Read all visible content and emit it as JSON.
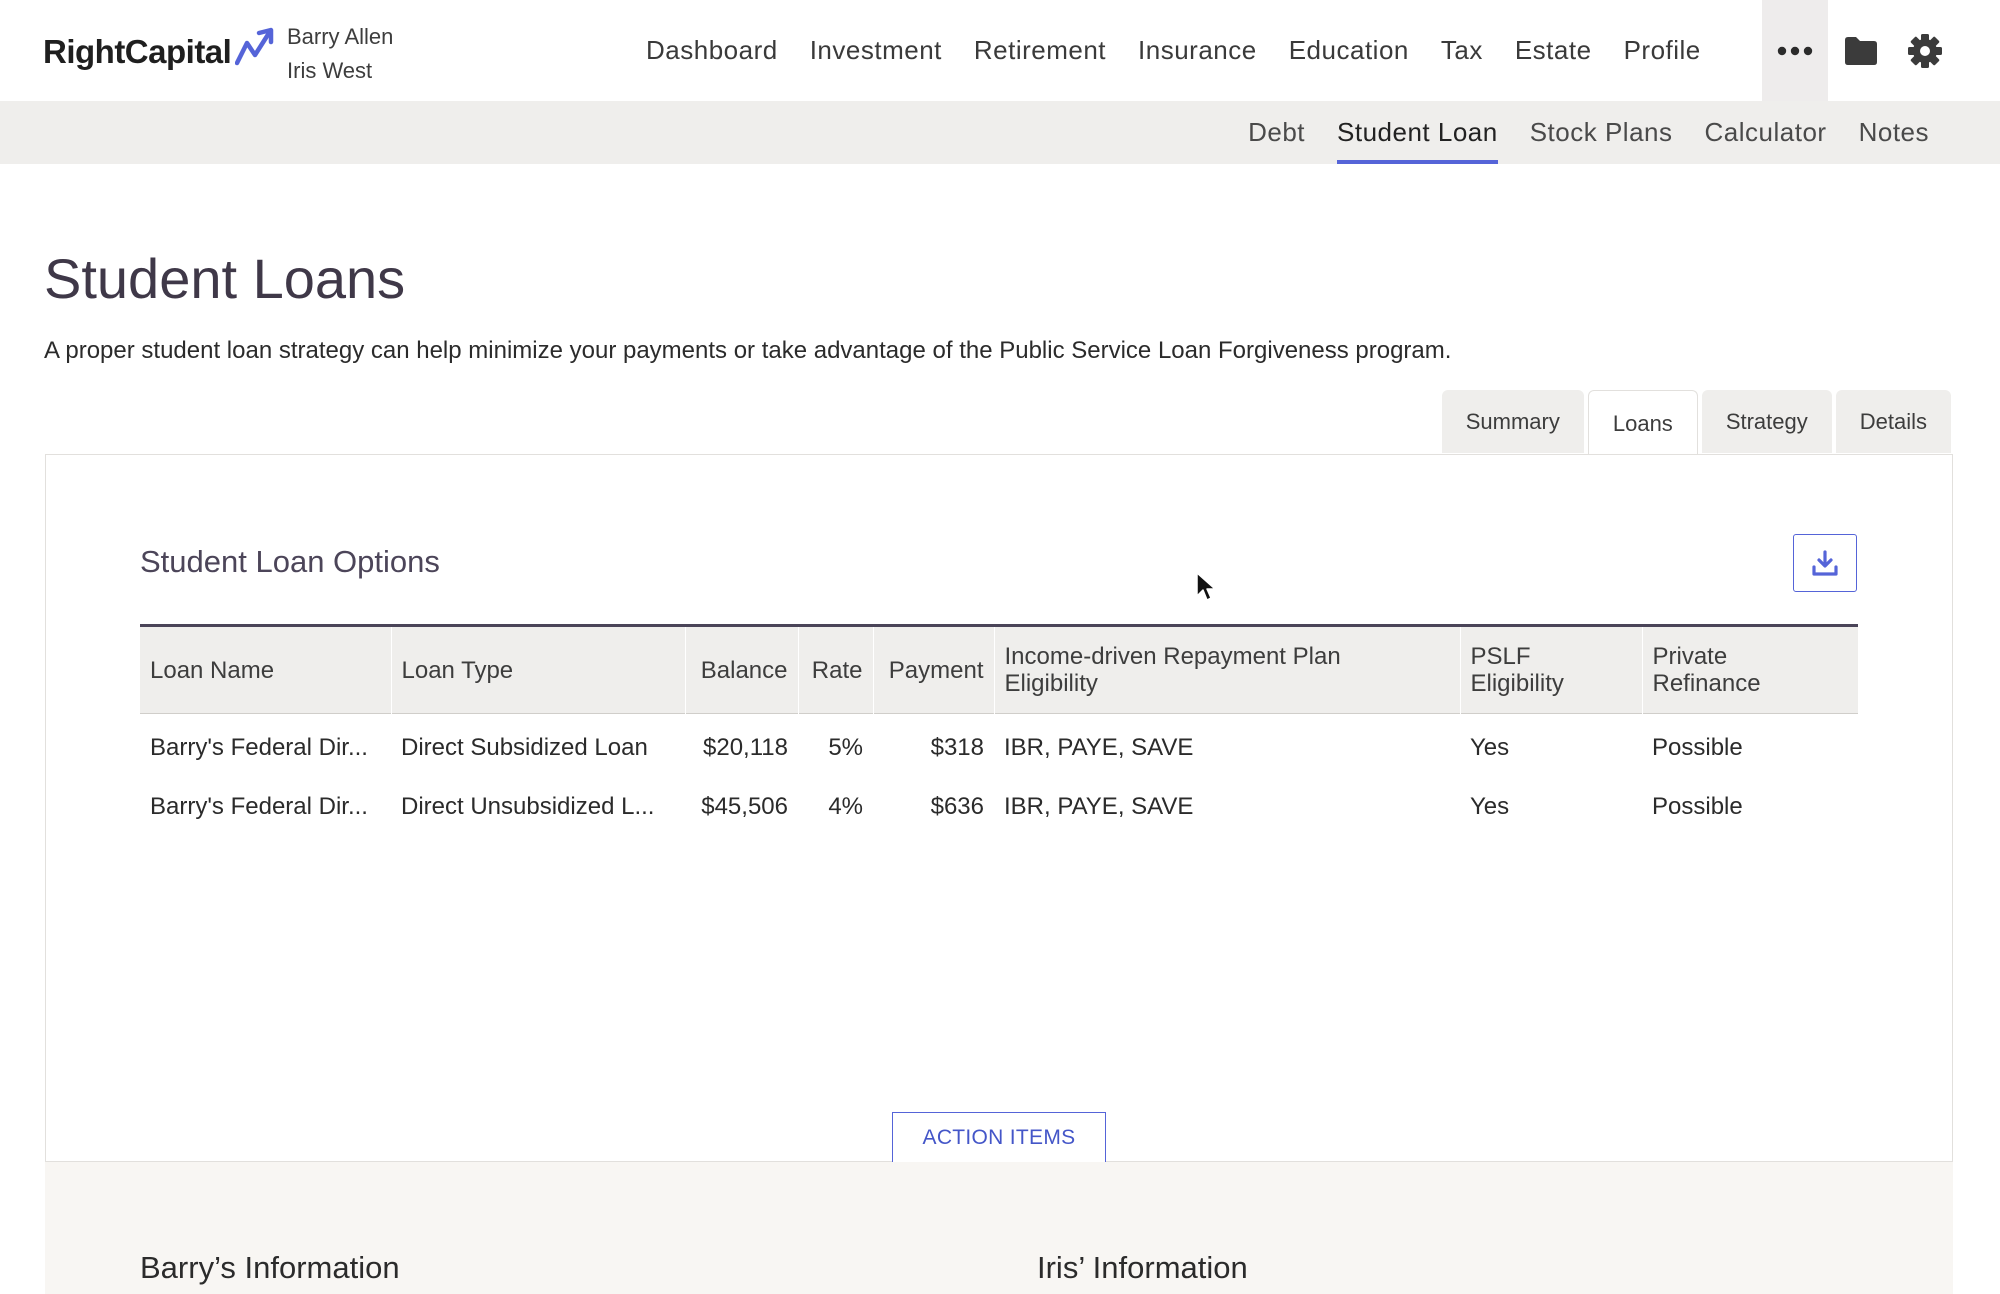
{
  "header": {
    "brand": "RightCapital",
    "clients": [
      "Barry Allen",
      "Iris West"
    ],
    "nav": [
      "Dashboard",
      "Investment",
      "Retirement",
      "Insurance",
      "Education",
      "Tax",
      "Estate",
      "Profile"
    ],
    "icons": [
      "more-icon",
      "folder-icon",
      "gear-icon"
    ]
  },
  "subnav": {
    "items": [
      "Debt",
      "Student Loan",
      "Stock Plans",
      "Calculator",
      "Notes"
    ],
    "active": "Student Loan"
  },
  "page": {
    "title": "Student Loans",
    "description": "A proper student loan strategy can help minimize your payments or take advantage of the Public Service Loan Forgiveness program."
  },
  "tabs": {
    "items": [
      "Summary",
      "Loans",
      "Strategy",
      "Details"
    ],
    "active": "Loans"
  },
  "card": {
    "title": "Student Loan Options",
    "download_icon": "download-icon",
    "columns": {
      "loan_name": "Loan Name",
      "loan_type": "Loan Type",
      "balance": "Balance",
      "rate": "Rate",
      "payment": "Payment",
      "idr_line1": "Income-driven Repayment Plan",
      "idr_line2": "Eligibility",
      "pslf_line1": "PSLF",
      "pslf_line2": "Eligibility",
      "refi_line1": "Private",
      "refi_line2": "Refinance"
    },
    "rows": [
      {
        "name": "Barry's Federal Dir...",
        "type": "Direct Subsidized Loan",
        "balance": "$20,118",
        "rate": "5%",
        "payment": "$318",
        "idr": "IBR, PAYE, SAVE",
        "pslf": "Yes",
        "refinance": "Possible"
      },
      {
        "name": "Barry's Federal Dir...",
        "type": "Direct Unsubsidized L...",
        "balance": "$45,506",
        "rate": "4%",
        "payment": "$636",
        "idr": "IBR, PAYE, SAVE",
        "pslf": "Yes",
        "refinance": "Possible"
      }
    ],
    "action_button": "ACTION ITEMS"
  },
  "info": {
    "left_title": "Barry’s Information",
    "right_title": "Iris’ Information"
  },
  "colors": {
    "accent": "#5564d8",
    "bar_bg": "#efeeec",
    "title": "#3f3848"
  }
}
